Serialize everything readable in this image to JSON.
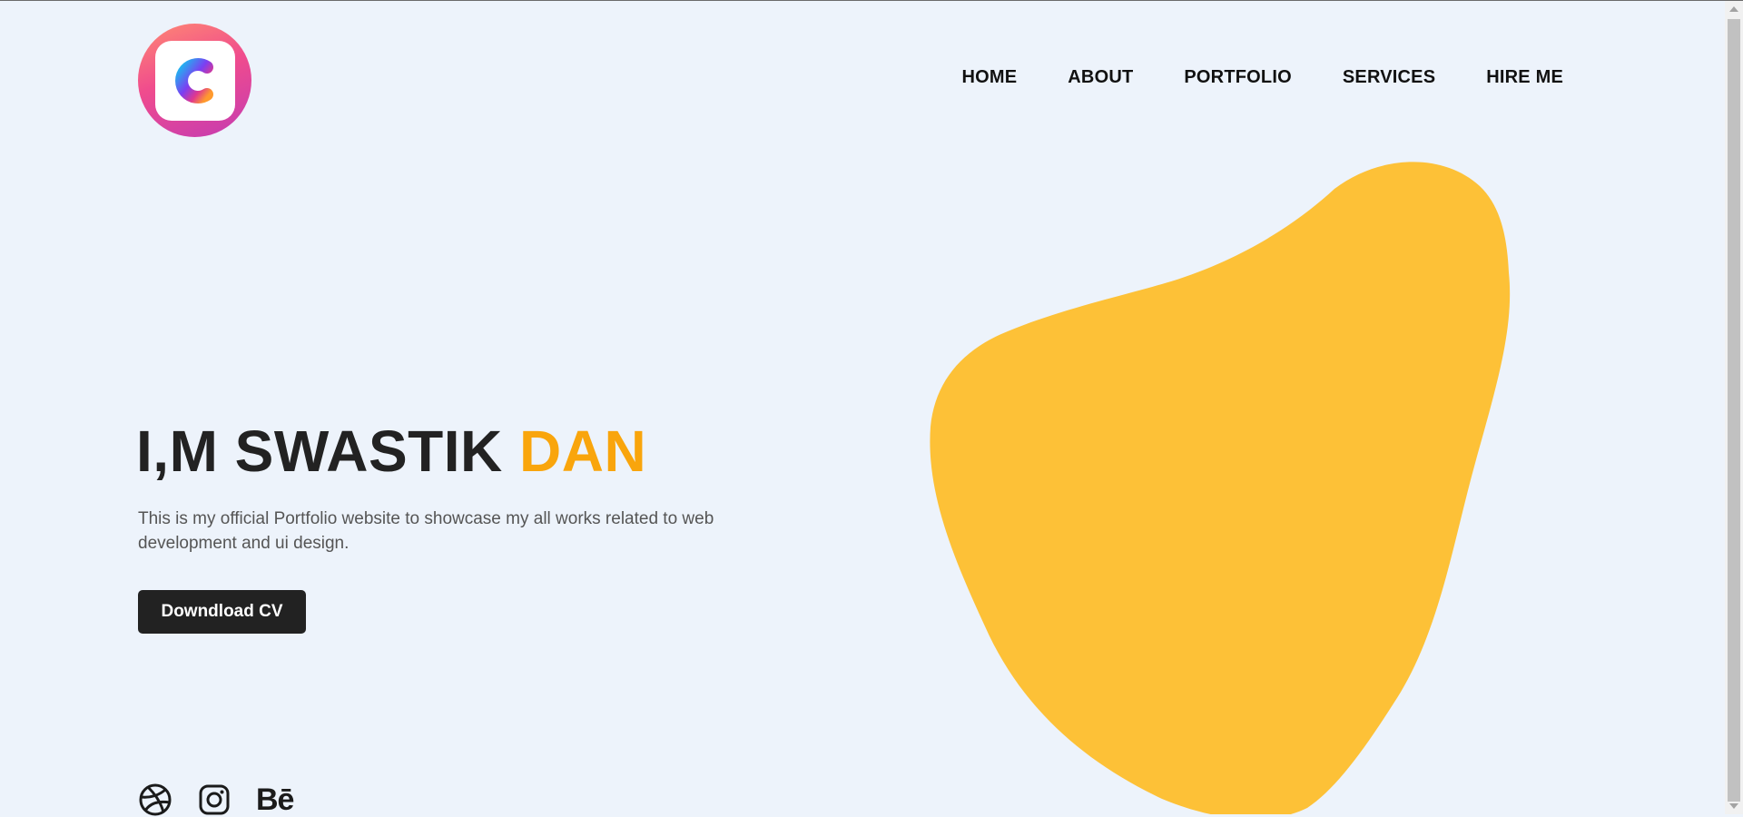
{
  "nav": {
    "items": [
      {
        "label": "HOME"
      },
      {
        "label": "ABOUT"
      },
      {
        "label": "PORTFOLIO"
      },
      {
        "label": "SERVICES"
      },
      {
        "label": "HIRE ME"
      }
    ]
  },
  "hero": {
    "title_main": "I,M SWASTIK ",
    "title_accent": "DAN",
    "description": "This is my official Portfolio website to showcase my all works related to web development and ui design.",
    "cta_label": "Downdload CV"
  },
  "social": {
    "behance_label": "Bē",
    "icons": [
      "dribbble-icon",
      "instagram-icon",
      "behance-icon"
    ]
  },
  "colors": {
    "background": "#edf3fb",
    "accent": "#f9a50c",
    "blob": "#fdc137",
    "button": "#222222"
  }
}
